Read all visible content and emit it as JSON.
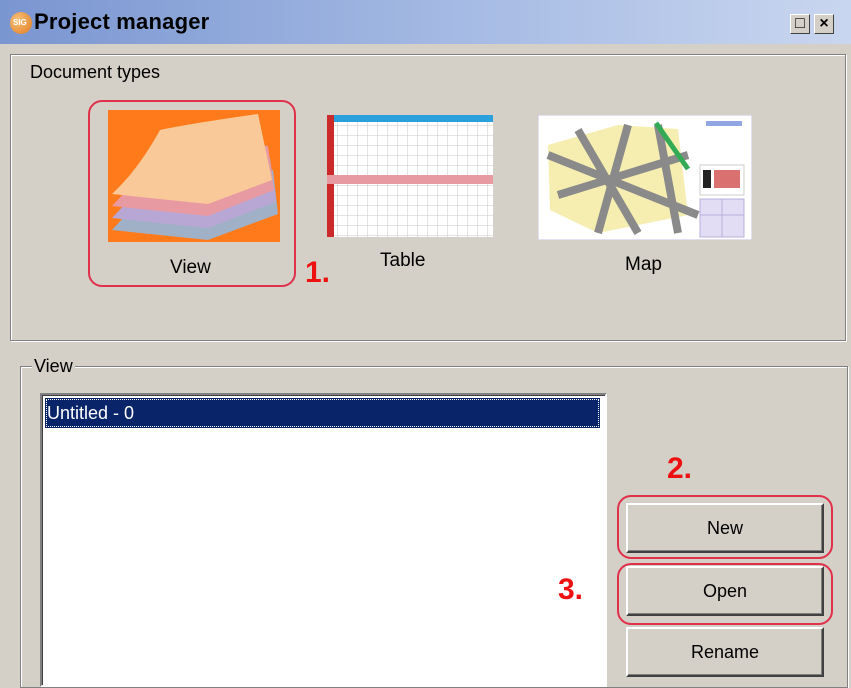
{
  "window": {
    "title": "Project manager",
    "icon": "sig-app-icon",
    "maximize_glyph": "□",
    "close_glyph": "×"
  },
  "document_types": {
    "group_label": "Document types",
    "items": [
      {
        "label": "View",
        "icon": "layers-view-icon"
      },
      {
        "label": "Table",
        "icon": "table-grid-icon"
      },
      {
        "label": "Map",
        "icon": "map-thumbnail-icon"
      }
    ]
  },
  "view_group": {
    "group_label": "View",
    "list_items": [
      "Untitled - 0"
    ],
    "selected_index": 0
  },
  "buttons": {
    "new": "New",
    "open": "Open",
    "rename": "Rename"
  },
  "annotations": {
    "step1": "1.",
    "step2": "2.",
    "step3": "3.",
    "highlight_color": "#e0304a",
    "step_color": "#ee1111"
  },
  "colors": {
    "selection": "#0a246a",
    "face": "#d4d0c8"
  }
}
